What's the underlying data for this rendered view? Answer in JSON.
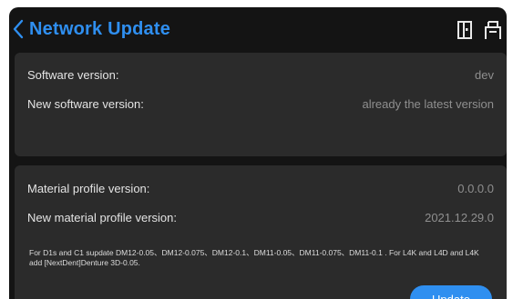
{
  "header": {
    "title": "Network Update",
    "back_icon": "chevron-left-icon",
    "icons": [
      "exit-door-icon",
      "printer-icon"
    ]
  },
  "software": {
    "version_label": "Software version:",
    "version_value": "dev",
    "new_version_label": "New software version:",
    "new_version_value": "already the latest version"
  },
  "material": {
    "version_label": "Material profile version:",
    "version_value": "0.0.0.0",
    "new_version_label": "New material profile version:",
    "new_version_value": "2021.12.29.0",
    "note": "For D1s and C1  supdate DM12-0.05、DM12-0.075、DM12-0.1、DM11-0.05、DM11-0.075、DM11-0.1  . For L4K and L4D and L4K  add [NextDent]Denture 3D-0.05."
  },
  "actions": {
    "update_label": "Update"
  },
  "colors": {
    "accent": "#2f8ff0",
    "background": "#141414",
    "card": "#2b2b2b"
  }
}
